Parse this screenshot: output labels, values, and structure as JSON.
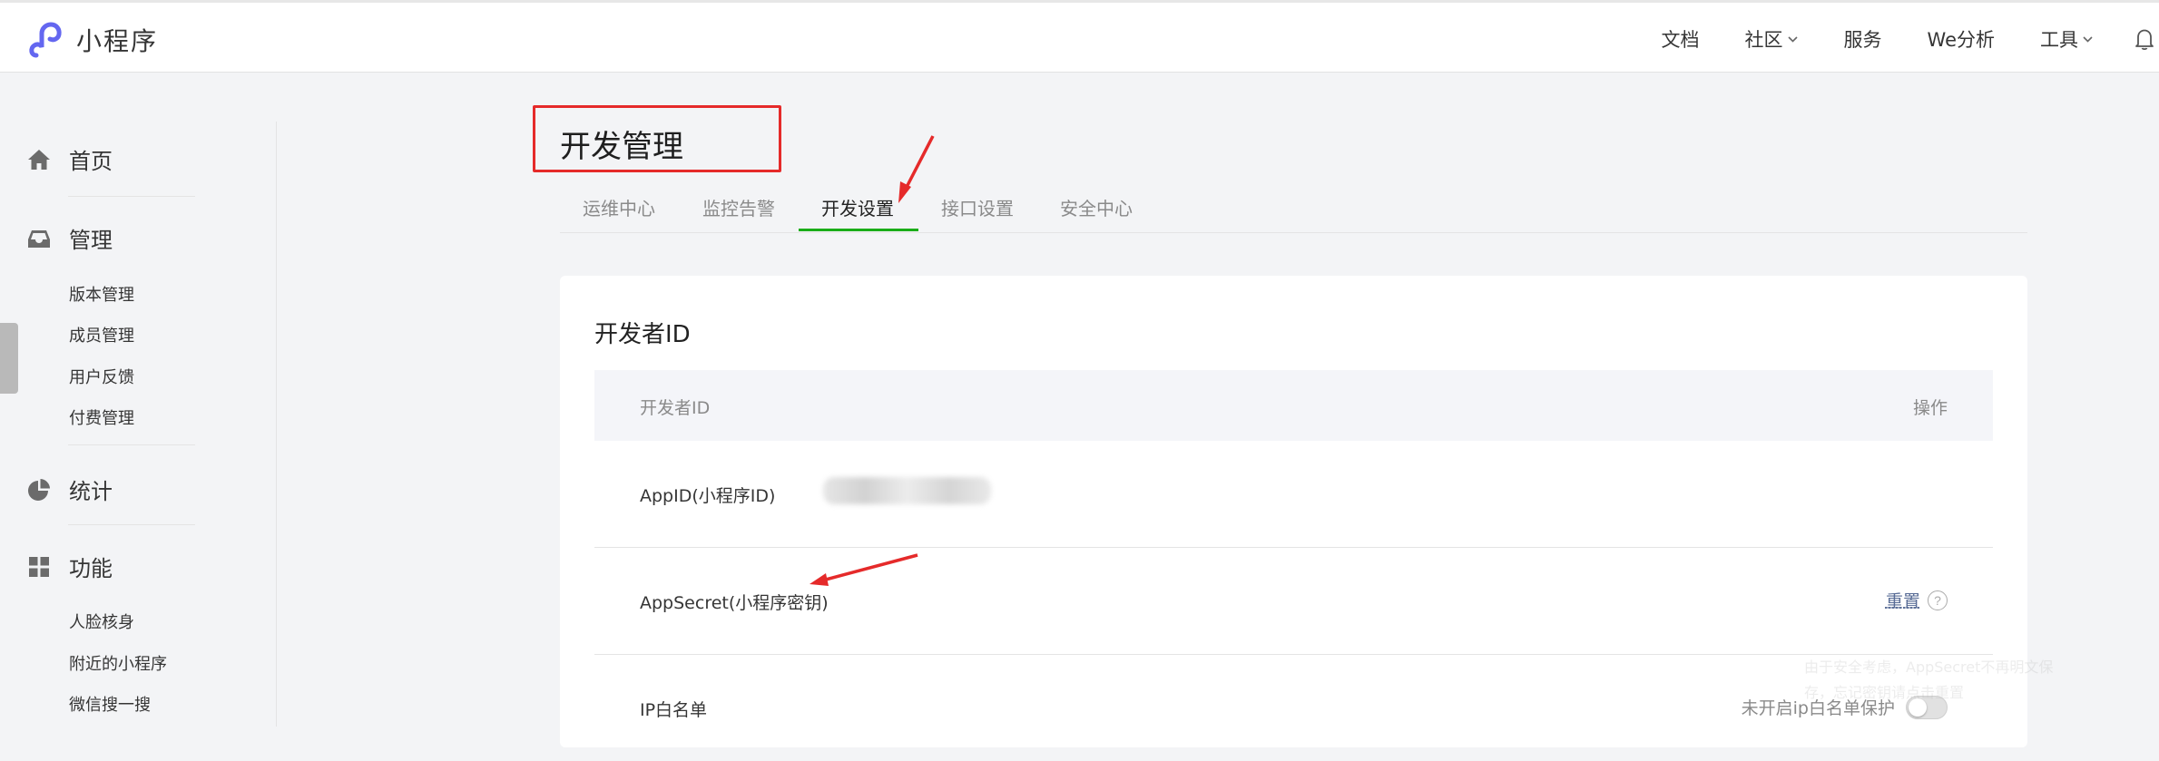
{
  "brand": {
    "name": "小程序",
    "logo_icon": "miniprogram-logo-icon",
    "accent": "#6467f0"
  },
  "topnav": {
    "items": [
      {
        "label": "文档",
        "has_dropdown": false
      },
      {
        "label": "社区",
        "has_dropdown": true
      },
      {
        "label": "服务",
        "has_dropdown": false
      },
      {
        "label": "We分析",
        "has_dropdown": false
      },
      {
        "label": "工具",
        "has_dropdown": true
      }
    ],
    "bell_icon": "bell-icon"
  },
  "sidebar": {
    "home": {
      "label": "首页",
      "icon": "home-icon"
    },
    "manage": {
      "label": "管理",
      "icon": "inbox-icon",
      "items": [
        "版本管理",
        "成员管理",
        "用户反馈",
        "付费管理"
      ]
    },
    "stats": {
      "label": "统计",
      "icon": "pie-chart-icon"
    },
    "features": {
      "label": "功能",
      "icon": "grid-icon",
      "items": [
        "人脸核身",
        "附近的小程序",
        "微信搜一搜"
      ]
    }
  },
  "page": {
    "title": "开发管理",
    "tabs": [
      {
        "label": "运维中心",
        "active": false
      },
      {
        "label": "监控告警",
        "active": false
      },
      {
        "label": "开发设置",
        "active": true
      },
      {
        "label": "接口设置",
        "active": false
      },
      {
        "label": "安全中心",
        "active": false
      }
    ]
  },
  "developer_id": {
    "title": "开发者ID",
    "table_headers": {
      "name": "开发者ID",
      "action": "操作"
    },
    "rows": {
      "appid": {
        "label": "AppID(小程序ID)",
        "value_redacted": true
      },
      "appsecret": {
        "label": "AppSecret(小程序密钥)",
        "action": "重置",
        "help_icon": "question-circle-icon",
        "tooltip": "由于安全考虑，AppSecret不再明文保存，忘记密钥请点击重置"
      },
      "ip_whitelist": {
        "label": "IP白名单",
        "status": "未开启ip白名单保护",
        "enabled": false
      }
    }
  },
  "colors": {
    "annotation_red": "#e52a2a",
    "tab_active_underline": "#1aad19",
    "link_blue": "#576b95"
  }
}
